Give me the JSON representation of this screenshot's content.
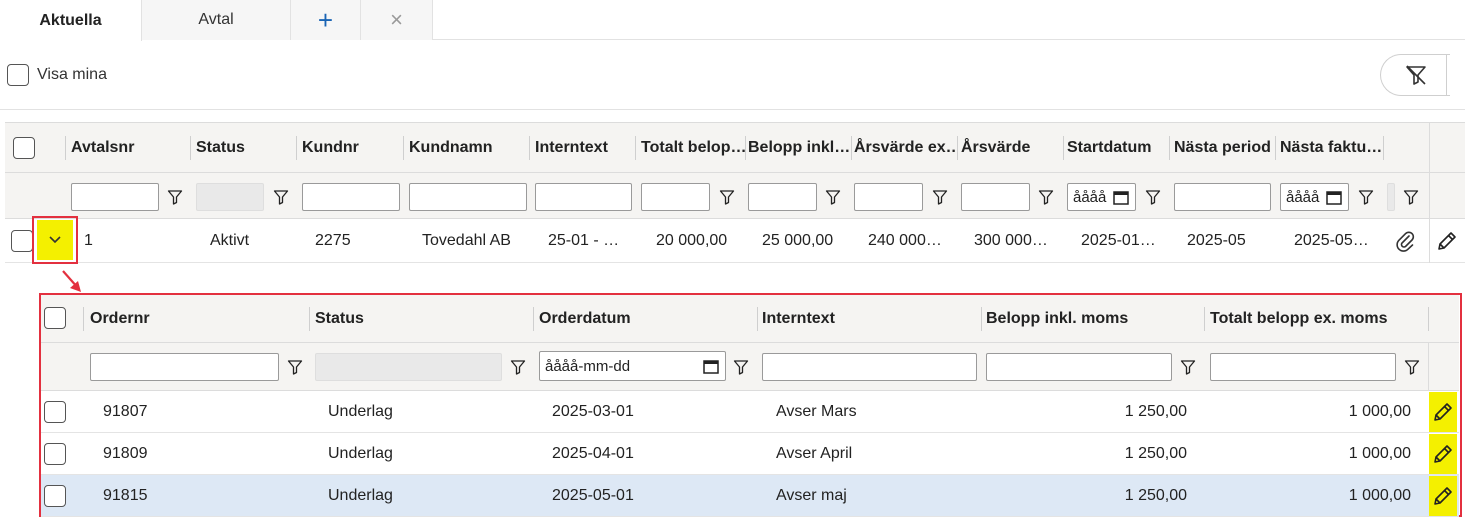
{
  "tabs": [
    {
      "label": "Aktuella",
      "active": true
    },
    {
      "label": "Avtal",
      "active": false
    },
    {
      "label": "+",
      "active": false
    },
    {
      "label": "×",
      "active": false
    }
  ],
  "toolbar": {
    "show_mine_label": "Visa mina",
    "clear_filter_icon": "filter-clear-icon"
  },
  "grid": {
    "columns": [
      "Avtalsnr",
      "Status",
      "Kundnr",
      "Kundnamn",
      "Interntext",
      "Totalt belop…",
      "Belopp inkl…",
      "Årsvärde ex…",
      "Årsvärde",
      "Startdatum",
      "Nästa period",
      "Nästa faktu…"
    ],
    "date_placeholder": "åååå",
    "rows": [
      {
        "cells": [
          "1",
          "Aktivt",
          "2275",
          "Tovedahl AB",
          "25-01 - …",
          "20 000,00",
          "25 000,00",
          "240 000…",
          "300 000…",
          "2025-01…",
          "2025-05",
          "2025-05…"
        ],
        "attachment_icon": "paperclip-icon",
        "edit_icon": "pencil-icon"
      }
    ]
  },
  "subgrid": {
    "columns": [
      "Ordernr",
      "Status",
      "Orderdatum",
      "Interntext",
      "Belopp inkl. moms",
      "Totalt belopp ex. moms"
    ],
    "date_placeholder": "åååå-mm-dd",
    "rows": [
      {
        "cells": [
          "91807",
          "Underlag",
          "2025-03-01",
          "Avser Mars",
          "1 250,00",
          "1 000,00"
        ],
        "selected": false
      },
      {
        "cells": [
          "91809",
          "Underlag",
          "2025-04-01",
          "Avser April",
          "1 250,00",
          "1 000,00"
        ],
        "selected": false
      },
      {
        "cells": [
          "91815",
          "Underlag",
          "2025-05-01",
          "Avser maj",
          "1 250,00",
          "1 000,00"
        ],
        "selected": true
      }
    ]
  },
  "colors": {
    "highlight_red": "#e3303f",
    "highlight_yellow": "#f4f000",
    "selected_row": "#dde8f5",
    "tab_plus_blue": "#1a64b4"
  }
}
